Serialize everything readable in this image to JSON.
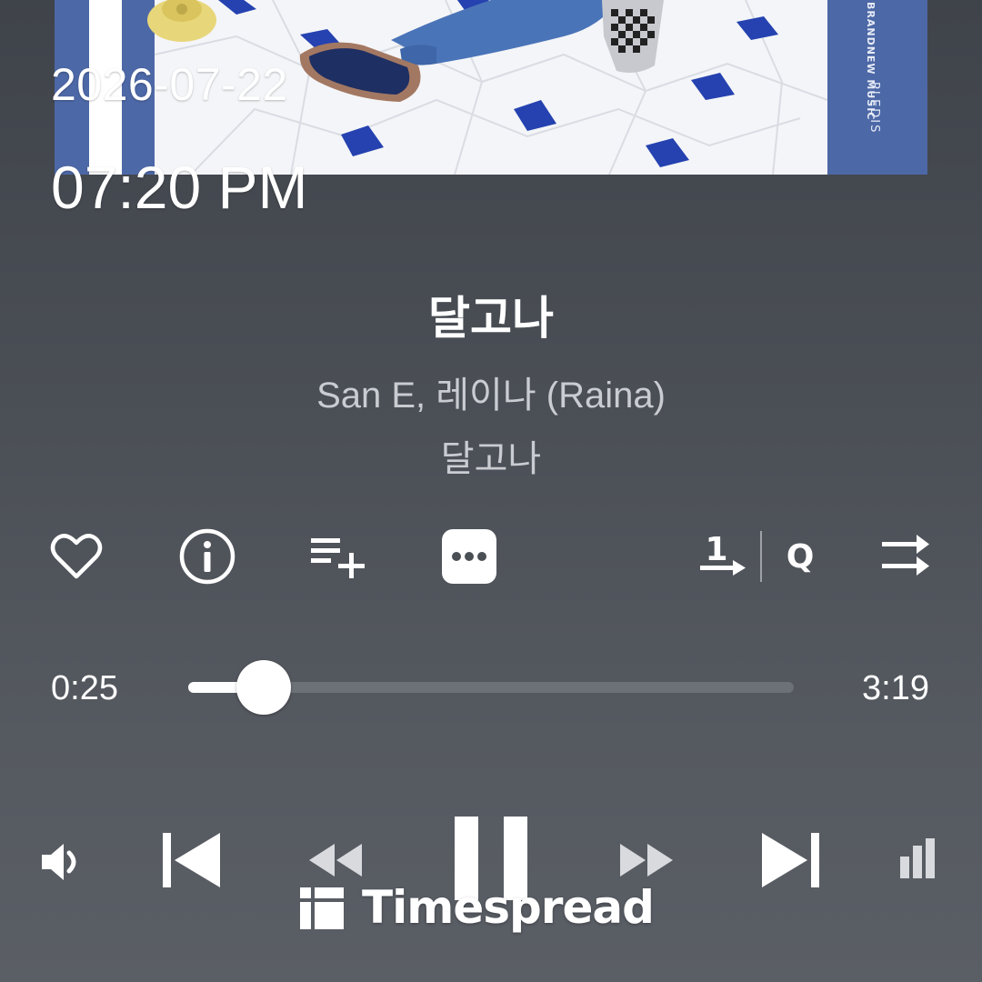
{
  "overlay": {
    "date": "2026-07-22",
    "time": "07:20 PM"
  },
  "album_art": {
    "brand_logo": "BRANDNEW MUSIC",
    "label_logo": "PLEDIS",
    "icon": "album-cover-image"
  },
  "track": {
    "title": "달고나",
    "artist": "San E, 레이나 (Raina)",
    "album": "달고나"
  },
  "actions": {
    "like": "heart-icon",
    "info": "info-icon",
    "add_to_playlist": "playlist-add-icon",
    "more": "more-icon",
    "repeat_label": "1",
    "queue_label": "Q",
    "shuffle": "shuffle-icon"
  },
  "progress": {
    "elapsed": "0:25",
    "total": "3:19",
    "fraction": 0.125
  },
  "controls": {
    "volume": "volume-icon",
    "previous": "skip-previous-icon",
    "rewind": "rewind-icon",
    "pause": "pause-icon",
    "fast_forward": "fast-forward-icon",
    "next": "skip-next-icon",
    "equalizer": "equalizer-icon"
  },
  "watermark": {
    "text": "Timespread"
  },
  "colors": {
    "accent": "#ffffff",
    "muted_text": "#c9ccd1",
    "label_blue": "#4d68a6",
    "tile_blue": "#2542b0"
  }
}
